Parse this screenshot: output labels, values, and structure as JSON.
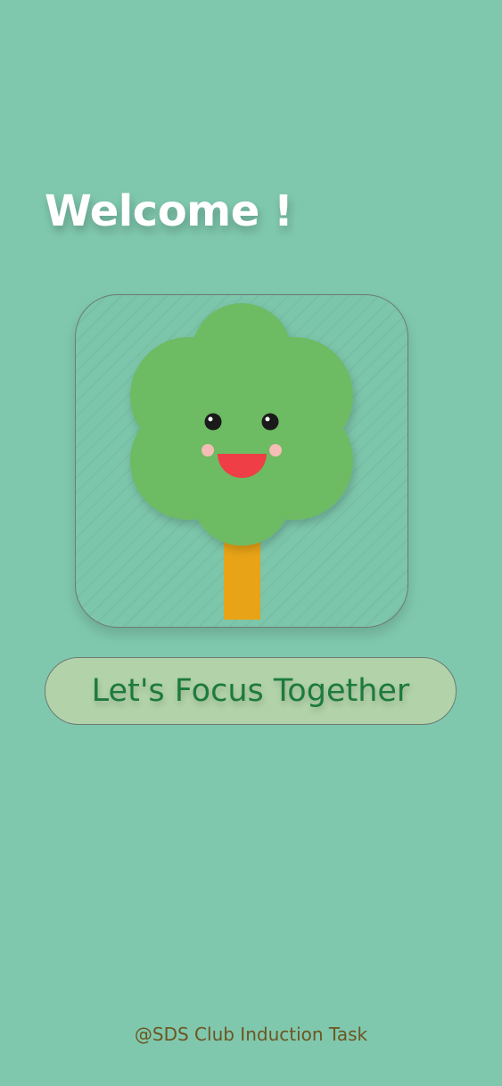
{
  "header": {
    "title": "Welcome !"
  },
  "hero": {
    "image": "smiling-tree-illustration",
    "colors": {
      "background": "#7fc8ae",
      "foliage": "#6dbb62",
      "trunk": "#e8a317",
      "mouth": "#ef3e45",
      "cheeks": "#f6bcb6",
      "eyes": "#1a1a1a"
    }
  },
  "actions": {
    "primary_label": "Let's Focus Together"
  },
  "footer": {
    "text": "@SDS Club Induction Task"
  }
}
